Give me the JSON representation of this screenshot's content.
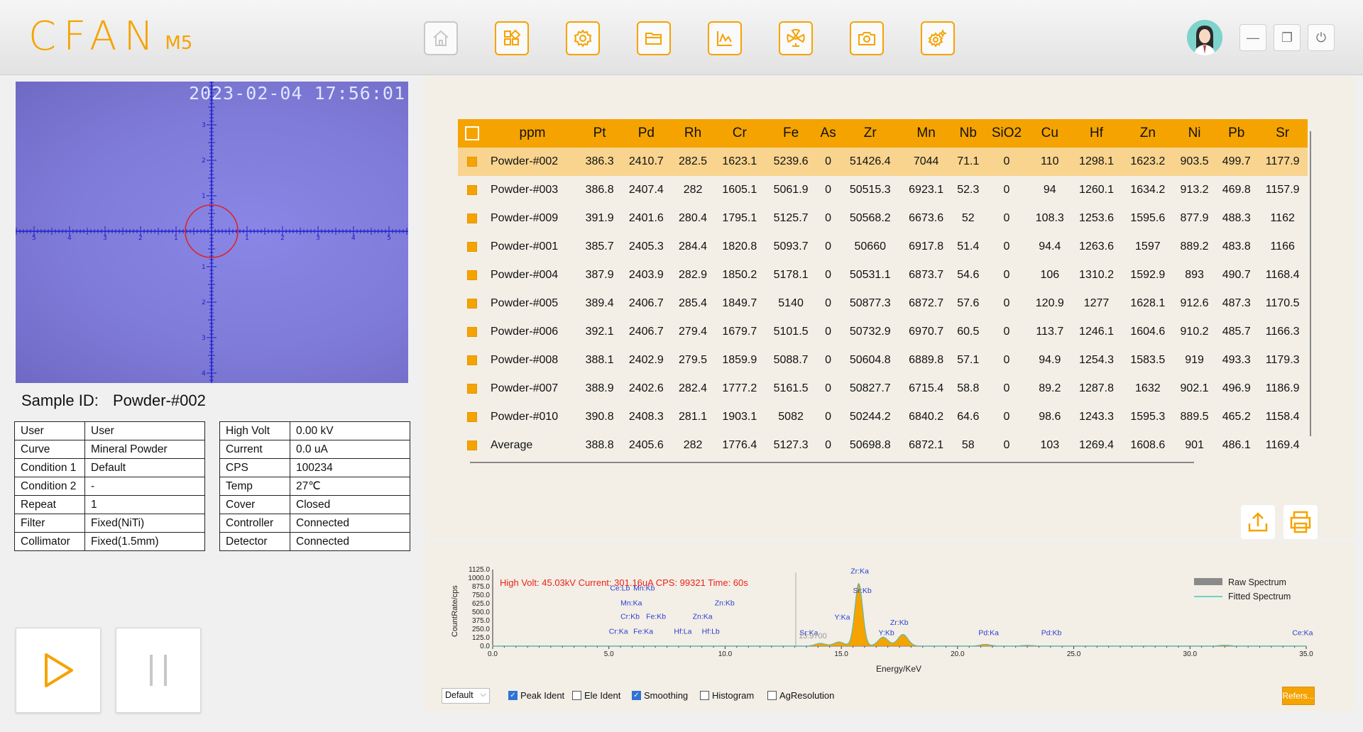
{
  "header": {
    "brand": "CFAN",
    "model": "M5",
    "nav": [
      {
        "name": "home-button",
        "icon": "home-icon"
      },
      {
        "name": "apps-button",
        "icon": "grid-plus-icon"
      },
      {
        "name": "settings-button",
        "icon": "gear-icon"
      },
      {
        "name": "folder-button",
        "icon": "folder-icon"
      },
      {
        "name": "chart-button",
        "icon": "chart-icon"
      },
      {
        "name": "radiation-button",
        "icon": "radiation-icon"
      },
      {
        "name": "camera-button",
        "icon": "camera-icon"
      },
      {
        "name": "advanced-settings-button",
        "icon": "gears-icon"
      }
    ],
    "window": {
      "minimize": "—",
      "restore": "❐",
      "power": "⏻"
    }
  },
  "camera": {
    "timestamp": "2023-02-04 17:56:01"
  },
  "sample": {
    "label": "Sample ID:",
    "value": "Powder-#002"
  },
  "info_left": [
    {
      "k": "User",
      "v": "User"
    },
    {
      "k": "Curve",
      "v": "Mineral Powder"
    },
    {
      "k": "Condition 1",
      "v": "Default"
    },
    {
      "k": "Condition 2",
      "v": "-"
    },
    {
      "k": "Repeat",
      "v": "1"
    },
    {
      "k": "Filter",
      "v": "Fixed(NiTi)"
    },
    {
      "k": "Collimator",
      "v": "Fixed(1.5mm)"
    }
  ],
  "info_right": [
    {
      "k": "High Volt",
      "v": "0.00 kV"
    },
    {
      "k": "Current",
      "v": "0.0 uA"
    },
    {
      "k": "CPS",
      "v": "100234"
    },
    {
      "k": "Temp",
      "v": "27℃"
    },
    {
      "k": "Cover",
      "v": "Closed"
    },
    {
      "k": "Controller",
      "v": "Connected"
    },
    {
      "k": "Detector",
      "v": "Connected"
    }
  ],
  "results": {
    "columns": [
      "ppm",
      "Pt",
      "Pd",
      "Rh",
      "Cr",
      "Fe",
      "As",
      "Zr",
      "Mn",
      "Nb",
      "SiO2",
      "Cu",
      "Hf",
      "Zn",
      "Ni",
      "Pb",
      "Sr"
    ],
    "rows": [
      [
        "Powder-#002",
        "386.3",
        "2410.7",
        "282.5",
        "1623.1",
        "5239.6",
        "0",
        "51426.4",
        "7044",
        "71.1",
        "0",
        "110",
        "1298.1",
        "1623.2",
        "903.5",
        "499.7",
        "1177.9"
      ],
      [
        "Powder-#003",
        "386.8",
        "2407.4",
        "282",
        "1605.1",
        "5061.9",
        "0",
        "50515.3",
        "6923.1",
        "52.3",
        "0",
        "94",
        "1260.1",
        "1634.2",
        "913.2",
        "469.8",
        "1157.9"
      ],
      [
        "Powder-#009",
        "391.9",
        "2401.6",
        "280.4",
        "1795.1",
        "5125.7",
        "0",
        "50568.2",
        "6673.6",
        "52",
        "0",
        "108.3",
        "1253.6",
        "1595.6",
        "877.9",
        "488.3",
        "1162"
      ],
      [
        "Powder-#001",
        "385.7",
        "2405.3",
        "284.4",
        "1820.8",
        "5093.7",
        "0",
        "50660",
        "6917.8",
        "51.4",
        "0",
        "94.4",
        "1263.6",
        "1597",
        "889.2",
        "483.8",
        "1166"
      ],
      [
        "Powder-#004",
        "387.9",
        "2403.9",
        "282.9",
        "1850.2",
        "5178.1",
        "0",
        "50531.1",
        "6873.7",
        "54.6",
        "0",
        "106",
        "1310.2",
        "1592.9",
        "893",
        "490.7",
        "1168.4"
      ],
      [
        "Powder-#005",
        "389.4",
        "2406.7",
        "285.4",
        "1849.7",
        "5140",
        "0",
        "50877.3",
        "6872.7",
        "57.6",
        "0",
        "120.9",
        "1277",
        "1628.1",
        "912.6",
        "487.3",
        "1170.5"
      ],
      [
        "Powder-#006",
        "392.1",
        "2406.7",
        "279.4",
        "1679.7",
        "5101.5",
        "0",
        "50732.9",
        "6970.7",
        "60.5",
        "0",
        "113.7",
        "1246.1",
        "1604.6",
        "910.2",
        "485.7",
        "1166.3"
      ],
      [
        "Powder-#008",
        "388.1",
        "2402.9",
        "279.5",
        "1859.9",
        "5088.7",
        "0",
        "50604.8",
        "6889.8",
        "57.1",
        "0",
        "94.9",
        "1254.3",
        "1583.5",
        "919",
        "493.3",
        "1179.3"
      ],
      [
        "Powder-#007",
        "388.9",
        "2402.6",
        "282.4",
        "1777.2",
        "5161.5",
        "0",
        "50827.7",
        "6715.4",
        "58.8",
        "0",
        "89.2",
        "1287.8",
        "1632",
        "902.1",
        "496.9",
        "1186.9"
      ],
      [
        "Powder-#010",
        "390.8",
        "2408.3",
        "281.1",
        "1903.1",
        "5082",
        "0",
        "50244.2",
        "6840.2",
        "64.6",
        "0",
        "98.6",
        "1243.3",
        "1595.3",
        "889.5",
        "465.2",
        "1158.4"
      ],
      [
        "Average",
        "388.8",
        "2405.6",
        "282",
        "1776.4",
        "5127.3",
        "0",
        "50698.8",
        "6872.1",
        "58",
        "0",
        "103",
        "1269.4",
        "1608.6",
        "901",
        "486.1",
        "1169.4"
      ]
    ]
  },
  "spectrum": {
    "status": "High Volt: 45.03kV  Current: 301.16uA  CPS: 99321  Time: 60s",
    "ylabel": "CountRate/cps",
    "xlabel": "Energy/KeV",
    "yticks": [
      "1125.0",
      "1000.0",
      "875.0",
      "750.0",
      "625.0",
      "500.0",
      "375.0",
      "250.0",
      "125.0",
      "0.0"
    ],
    "xticks": [
      "0.0",
      "5.0",
      "10.0",
      "15.0",
      "20.0",
      "25.0",
      "30.0",
      "35.0"
    ],
    "legend": [
      "Raw Spectrum",
      "Fitted Spectrum"
    ],
    "cursor_label": "13.9700",
    "colors": {
      "status": "#e8221b",
      "peak": "#f5a300",
      "label": "#2a3fd0",
      "fitted": "#3ec9c0"
    },
    "chart_data": {
      "type": "area",
      "xlim": [
        0,
        35
      ],
      "ylim": [
        0,
        1125
      ],
      "peaks": [
        {
          "x": 14.1,
          "y": 40
        },
        {
          "x": 14.9,
          "y": 60
        },
        {
          "x": 15.75,
          "y": 920
        },
        {
          "x": 16.8,
          "y": 130
        },
        {
          "x": 17.65,
          "y": 170
        },
        {
          "x": 21.2,
          "y": 25
        },
        {
          "x": 23.0,
          "y": 10
        },
        {
          "x": 31.5,
          "y": 12
        }
      ]
    },
    "labels": [
      {
        "t": "Ce:Lb",
        "x": 5.05,
        "y": 820
      },
      {
        "t": "Mn:Kb",
        "x": 6.05,
        "y": 820
      },
      {
        "t": "Mn:Ka",
        "x": 5.5,
        "y": 600
      },
      {
        "t": "Zn:Kb",
        "x": 9.55,
        "y": 600
      },
      {
        "t": "Cr:Kb",
        "x": 5.5,
        "y": 400
      },
      {
        "t": "Fe:Kb",
        "x": 6.6,
        "y": 400
      },
      {
        "t": "Zn:Ka",
        "x": 8.6,
        "y": 400
      },
      {
        "t": "Cr:Ka",
        "x": 5.0,
        "y": 180
      },
      {
        "t": "Fe:Ka",
        "x": 6.05,
        "y": 180
      },
      {
        "t": "Hf:La",
        "x": 7.8,
        "y": 180
      },
      {
        "t": "Hf:Lb",
        "x": 9.0,
        "y": 180
      },
      {
        "t": "Zr:Ka",
        "x": 15.4,
        "y": 1070
      },
      {
        "t": "Sr:Kb",
        "x": 15.5,
        "y": 780
      },
      {
        "t": "Y:Ka",
        "x": 14.7,
        "y": 390
      },
      {
        "t": "Zr:Kb",
        "x": 17.1,
        "y": 310
      },
      {
        "t": "Sr:Ka",
        "x": 13.2,
        "y": 160
      },
      {
        "t": "Y:Kb",
        "x": 16.6,
        "y": 160
      },
      {
        "t": "Pd:Ka",
        "x": 20.9,
        "y": 160
      },
      {
        "t": "Pd:Kb",
        "x": 23.6,
        "y": 160
      },
      {
        "t": "Ce:Ka",
        "x": 34.4,
        "y": 160
      }
    ]
  },
  "bottom": {
    "preset": "Default",
    "checks": [
      {
        "label": "Peak Ident",
        "on": true
      },
      {
        "label": "Ele Ident",
        "on": false
      },
      {
        "label": "Smoothing",
        "on": true
      },
      {
        "label": "Histogram",
        "on": false
      },
      {
        "label": "AgResolution",
        "on": false
      }
    ],
    "refer": "Refers..."
  }
}
